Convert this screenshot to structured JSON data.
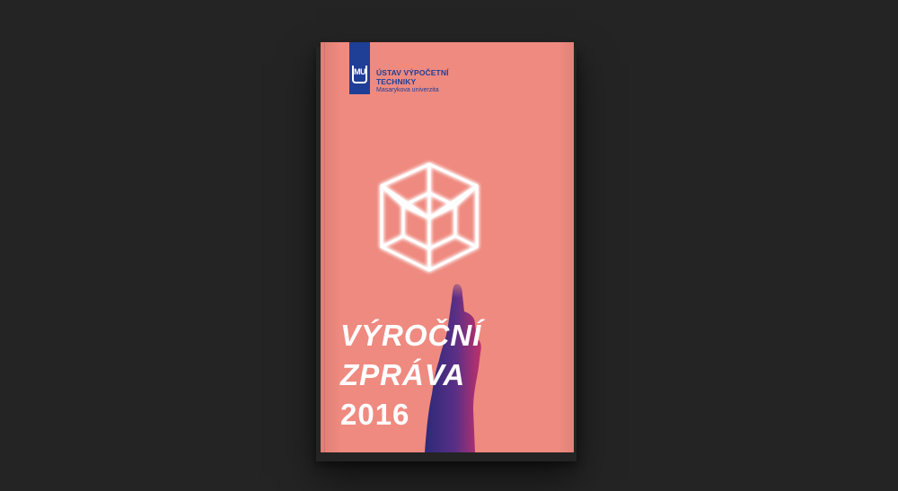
{
  "institution": {
    "name": "ÚSTAV VÝPOČETNÍ\nTECHNIKY",
    "subtitle": "Masarykova univerzita",
    "logo_text": "MU"
  },
  "cover": {
    "title_line1": "VÝROČNÍ",
    "title_line2": "ZPRÁVA",
    "title_line3": "2016",
    "illustration": "glowing-tesseract-above-hand-icon"
  },
  "colors": {
    "background": "#242424",
    "cover": "#ef8a80",
    "brand_blue": "#1f3e95",
    "text_white": "#ffffff",
    "hand_dark": "#3a2a6e"
  }
}
